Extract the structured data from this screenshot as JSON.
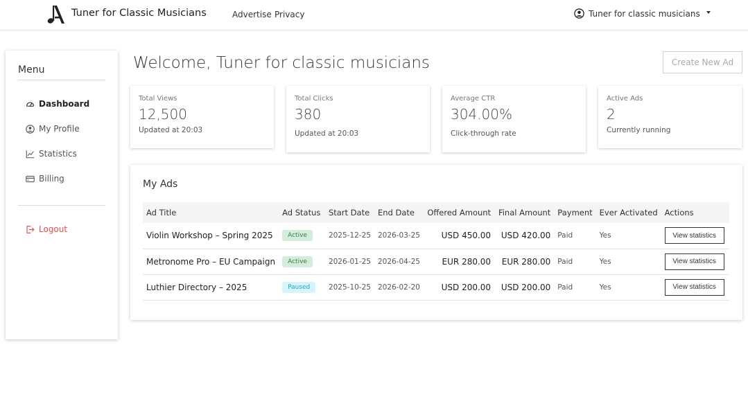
{
  "header": {
    "brand": "Tuner for Classic Musicians",
    "nav": [
      "Advertise",
      "Privacy"
    ],
    "user_name": "Tuner for classic musicians"
  },
  "sidebar": {
    "title": "Menu",
    "items": [
      {
        "label": "Dashboard",
        "icon": "dashboard-icon",
        "active": true
      },
      {
        "label": "My Profile",
        "icon": "user-circle-icon",
        "active": false
      },
      {
        "label": "Statistics",
        "icon": "chart-line-icon",
        "active": false
      },
      {
        "label": "Billing",
        "icon": "credit-card-icon",
        "active": false
      }
    ],
    "logout": "Logout"
  },
  "main": {
    "welcome": "Welcome, Tuner for classic musicians",
    "create_button": "Create New Ad",
    "stats": [
      {
        "label": "Total Views",
        "value": "12,500",
        "sub": "Updated at 20:03"
      },
      {
        "label": "Total Clicks",
        "value": "380",
        "sub": "Updated at 20:03"
      },
      {
        "label": "Average CTR",
        "value": "304.00%",
        "sub": "Click-through rate"
      },
      {
        "label": "Active Ads",
        "value": "2",
        "sub": "Currently running"
      }
    ],
    "ads_title": "My Ads",
    "columns": [
      "Ad Title",
      "Ad Status",
      "Start Date",
      "End Date",
      "Offered Amount",
      "Final Amount",
      "Payment",
      "Ever Activated",
      "Actions"
    ],
    "rows": [
      {
        "title": "Violin Workshop – Spring 2025",
        "status": "Active",
        "start": "2025-12-25",
        "end": "2026-03-25",
        "offered": "USD 450.00",
        "final": "USD 420.00",
        "payment": "Paid",
        "activated": "Yes",
        "action": "View statistics"
      },
      {
        "title": "Metronome Pro – EU Campaign",
        "status": "Active",
        "start": "2026-01-25",
        "end": "2026-04-25",
        "offered": "EUR 280.00",
        "final": "EUR 280.00",
        "payment": "Paid",
        "activated": "Yes",
        "action": "View statistics"
      },
      {
        "title": "Luthier Directory – 2025",
        "status": "Paused",
        "start": "2025-10-25",
        "end": "2026-02-20",
        "offered": "USD 200.00",
        "final": "USD 200.00",
        "payment": "Paid",
        "activated": "Yes",
        "action": "View statistics"
      }
    ]
  },
  "colors": {
    "active_badge_bg": "#d4edda",
    "paused_badge_bg": "#d4f5fb",
    "logout": "#d9534f"
  }
}
